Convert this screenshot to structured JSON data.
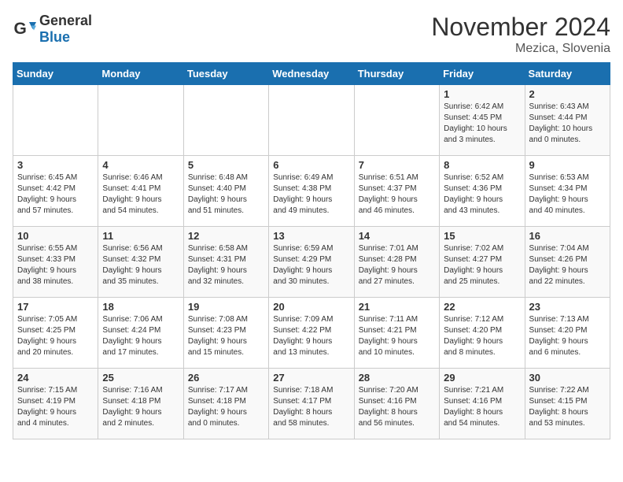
{
  "header": {
    "logo_general": "General",
    "logo_blue": "Blue",
    "month_title": "November 2024",
    "location": "Mezica, Slovenia"
  },
  "days_of_week": [
    "Sunday",
    "Monday",
    "Tuesday",
    "Wednesday",
    "Thursday",
    "Friday",
    "Saturday"
  ],
  "weeks": [
    [
      {
        "day": "",
        "info": ""
      },
      {
        "day": "",
        "info": ""
      },
      {
        "day": "",
        "info": ""
      },
      {
        "day": "",
        "info": ""
      },
      {
        "day": "",
        "info": ""
      },
      {
        "day": "1",
        "info": "Sunrise: 6:42 AM\nSunset: 4:45 PM\nDaylight: 10 hours\nand 3 minutes."
      },
      {
        "day": "2",
        "info": "Sunrise: 6:43 AM\nSunset: 4:44 PM\nDaylight: 10 hours\nand 0 minutes."
      }
    ],
    [
      {
        "day": "3",
        "info": "Sunrise: 6:45 AM\nSunset: 4:42 PM\nDaylight: 9 hours\nand 57 minutes."
      },
      {
        "day": "4",
        "info": "Sunrise: 6:46 AM\nSunset: 4:41 PM\nDaylight: 9 hours\nand 54 minutes."
      },
      {
        "day": "5",
        "info": "Sunrise: 6:48 AM\nSunset: 4:40 PM\nDaylight: 9 hours\nand 51 minutes."
      },
      {
        "day": "6",
        "info": "Sunrise: 6:49 AM\nSunset: 4:38 PM\nDaylight: 9 hours\nand 49 minutes."
      },
      {
        "day": "7",
        "info": "Sunrise: 6:51 AM\nSunset: 4:37 PM\nDaylight: 9 hours\nand 46 minutes."
      },
      {
        "day": "8",
        "info": "Sunrise: 6:52 AM\nSunset: 4:36 PM\nDaylight: 9 hours\nand 43 minutes."
      },
      {
        "day": "9",
        "info": "Sunrise: 6:53 AM\nSunset: 4:34 PM\nDaylight: 9 hours\nand 40 minutes."
      }
    ],
    [
      {
        "day": "10",
        "info": "Sunrise: 6:55 AM\nSunset: 4:33 PM\nDaylight: 9 hours\nand 38 minutes."
      },
      {
        "day": "11",
        "info": "Sunrise: 6:56 AM\nSunset: 4:32 PM\nDaylight: 9 hours\nand 35 minutes."
      },
      {
        "day": "12",
        "info": "Sunrise: 6:58 AM\nSunset: 4:31 PM\nDaylight: 9 hours\nand 32 minutes."
      },
      {
        "day": "13",
        "info": "Sunrise: 6:59 AM\nSunset: 4:29 PM\nDaylight: 9 hours\nand 30 minutes."
      },
      {
        "day": "14",
        "info": "Sunrise: 7:01 AM\nSunset: 4:28 PM\nDaylight: 9 hours\nand 27 minutes."
      },
      {
        "day": "15",
        "info": "Sunrise: 7:02 AM\nSunset: 4:27 PM\nDaylight: 9 hours\nand 25 minutes."
      },
      {
        "day": "16",
        "info": "Sunrise: 7:04 AM\nSunset: 4:26 PM\nDaylight: 9 hours\nand 22 minutes."
      }
    ],
    [
      {
        "day": "17",
        "info": "Sunrise: 7:05 AM\nSunset: 4:25 PM\nDaylight: 9 hours\nand 20 minutes."
      },
      {
        "day": "18",
        "info": "Sunrise: 7:06 AM\nSunset: 4:24 PM\nDaylight: 9 hours\nand 17 minutes."
      },
      {
        "day": "19",
        "info": "Sunrise: 7:08 AM\nSunset: 4:23 PM\nDaylight: 9 hours\nand 15 minutes."
      },
      {
        "day": "20",
        "info": "Sunrise: 7:09 AM\nSunset: 4:22 PM\nDaylight: 9 hours\nand 13 minutes."
      },
      {
        "day": "21",
        "info": "Sunrise: 7:11 AM\nSunset: 4:21 PM\nDaylight: 9 hours\nand 10 minutes."
      },
      {
        "day": "22",
        "info": "Sunrise: 7:12 AM\nSunset: 4:20 PM\nDaylight: 9 hours\nand 8 minutes."
      },
      {
        "day": "23",
        "info": "Sunrise: 7:13 AM\nSunset: 4:20 PM\nDaylight: 9 hours\nand 6 minutes."
      }
    ],
    [
      {
        "day": "24",
        "info": "Sunrise: 7:15 AM\nSunset: 4:19 PM\nDaylight: 9 hours\nand 4 minutes."
      },
      {
        "day": "25",
        "info": "Sunrise: 7:16 AM\nSunset: 4:18 PM\nDaylight: 9 hours\nand 2 minutes."
      },
      {
        "day": "26",
        "info": "Sunrise: 7:17 AM\nSunset: 4:18 PM\nDaylight: 9 hours\nand 0 minutes."
      },
      {
        "day": "27",
        "info": "Sunrise: 7:18 AM\nSunset: 4:17 PM\nDaylight: 8 hours\nand 58 minutes."
      },
      {
        "day": "28",
        "info": "Sunrise: 7:20 AM\nSunset: 4:16 PM\nDaylight: 8 hours\nand 56 minutes."
      },
      {
        "day": "29",
        "info": "Sunrise: 7:21 AM\nSunset: 4:16 PM\nDaylight: 8 hours\nand 54 minutes."
      },
      {
        "day": "30",
        "info": "Sunrise: 7:22 AM\nSunset: 4:15 PM\nDaylight: 8 hours\nand 53 minutes."
      }
    ]
  ]
}
